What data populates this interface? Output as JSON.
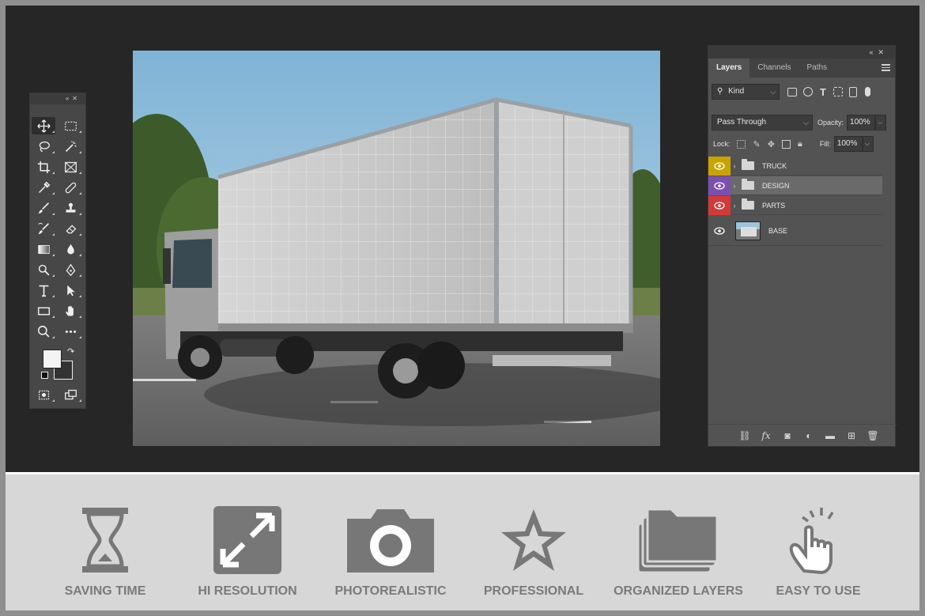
{
  "layers_panel": {
    "tabs": [
      "Layers",
      "Channels",
      "Paths"
    ],
    "filter_kind": "Kind",
    "blend_mode": "Pass Through",
    "opacity_label": "Opacity:",
    "opacity_value": "100%",
    "lock_label": "Lock:",
    "fill_label": "Fill:",
    "fill_value": "100%",
    "layers": [
      {
        "name": "TRUCK",
        "type": "group",
        "color": "#c9a400"
      },
      {
        "name": "DESIGN",
        "type": "group",
        "color": "#7b4fb0"
      },
      {
        "name": "PARTS",
        "type": "group",
        "color": "#d23a3a"
      },
      {
        "name": "BASE",
        "type": "image",
        "color": ""
      }
    ]
  },
  "features": [
    {
      "label": "SAVING TIME",
      "icon": "hourglass-icon"
    },
    {
      "label": "HI RESOLUTION",
      "icon": "expand-icon"
    },
    {
      "label": "PHOTOREALISTIC",
      "icon": "camera-icon"
    },
    {
      "label": "PROFESSIONAL",
      "icon": "star-icon"
    },
    {
      "label": "ORGANIZED LAYERS",
      "icon": "layers-folder-icon"
    },
    {
      "label": "EASY TO USE",
      "icon": "tap-hand-icon"
    }
  ],
  "colors": {
    "workspace": "#262626",
    "panel": "#535353",
    "feature_bg": "#d7d7d7",
    "feature_icon": "#777777"
  }
}
